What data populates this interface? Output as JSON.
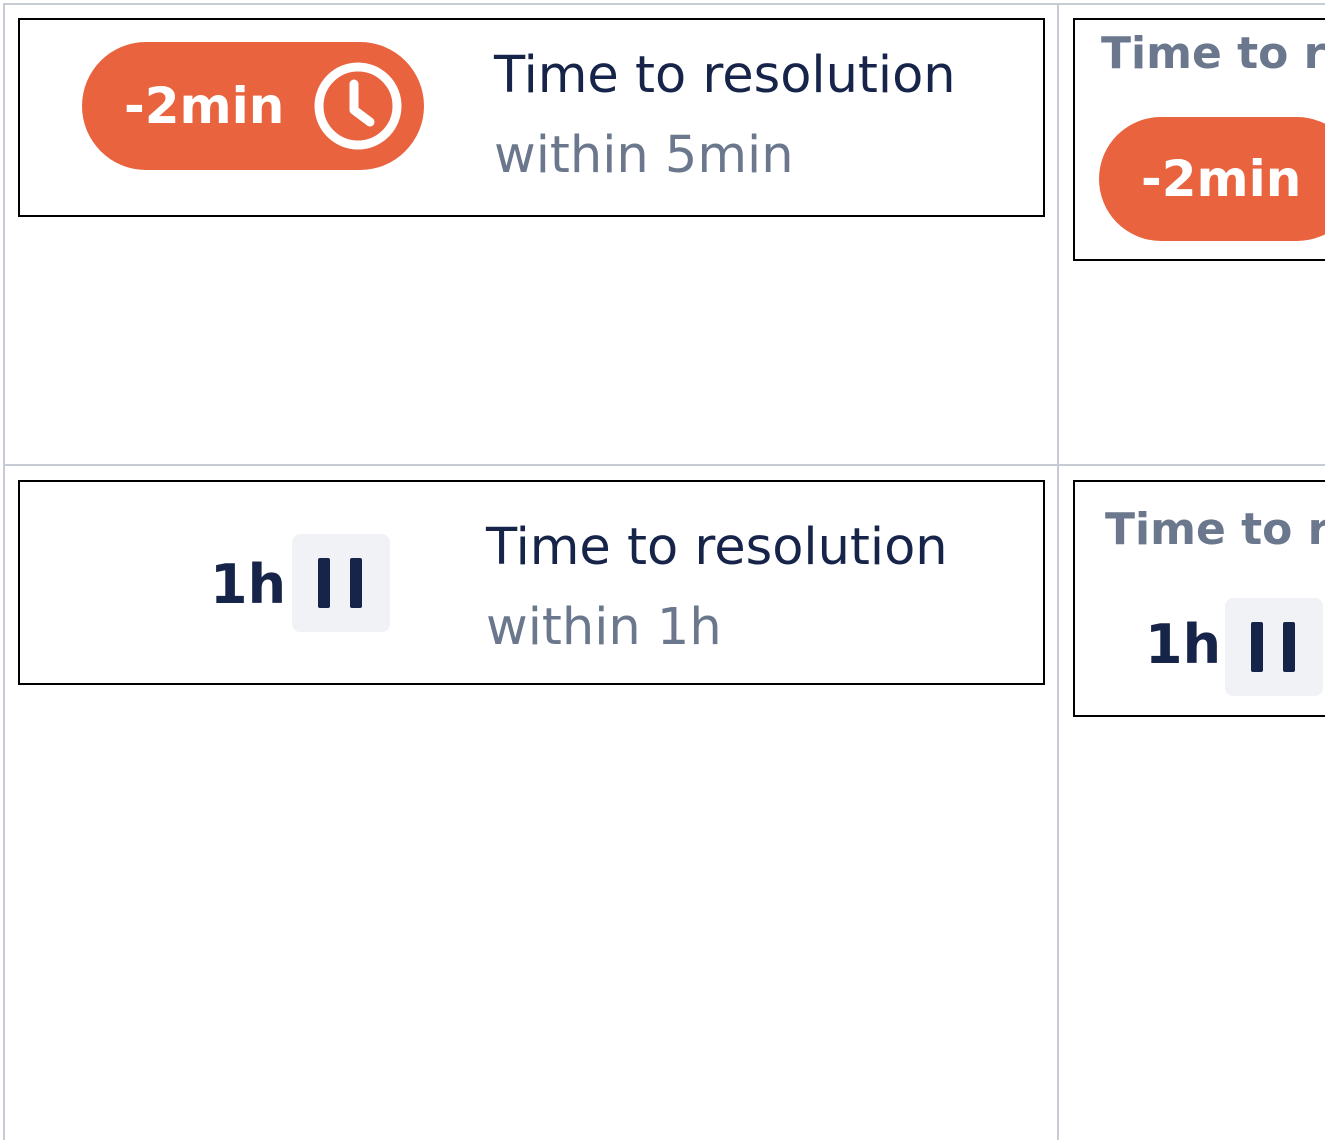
{
  "sla_cards": [
    {
      "variant": "expanded",
      "status": "breached",
      "value": "-2min",
      "icon": "clock-icon",
      "title": "Time to resolution",
      "goal": "within 5min"
    },
    {
      "variant": "compact",
      "status": "breached",
      "title": "Time to re",
      "value": "-2min"
    },
    {
      "variant": "expanded",
      "status": "paused",
      "value": "1h",
      "icon": "pause-icon",
      "title": "Time to resolution",
      "goal": "within 1h"
    },
    {
      "variant": "compact",
      "status": "paused",
      "title": "Time to r",
      "value": "1h",
      "icon": "pause-icon"
    }
  ],
  "colors": {
    "breached": "#e9633f",
    "title_text": "#17244a",
    "muted_text": "#6b778c",
    "pause_bg": "#f1f2f5",
    "grid_line": "#c7ccd4"
  }
}
